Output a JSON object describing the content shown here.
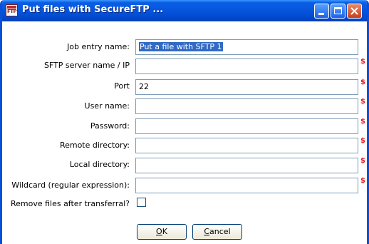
{
  "window": {
    "title": "Put files with SecureFTP ...",
    "app_icon_text": "FTP"
  },
  "form": {
    "job_entry_name": {
      "label": "Job entry name:",
      "value": "Put a file with SFTP 1"
    },
    "server": {
      "label": "SFTP server name / IP",
      "value": ""
    },
    "port": {
      "label": "Port",
      "value": "22"
    },
    "user": {
      "label": "User name:",
      "value": ""
    },
    "password": {
      "label": "Password:",
      "value": ""
    },
    "remote_dir": {
      "label": "Remote directory:",
      "value": ""
    },
    "local_dir": {
      "label": "Local directory:",
      "value": ""
    },
    "wildcard": {
      "label": "Wildcard (regular expression):",
      "value": ""
    },
    "remove_files": {
      "label": "Remove files after transferral?",
      "checked": false
    },
    "variable_marker": "$"
  },
  "buttons": {
    "ok": {
      "mnemonic": "O",
      "rest": "K"
    },
    "cancel": {
      "mnemonic": "C",
      "rest": "ancel"
    }
  }
}
